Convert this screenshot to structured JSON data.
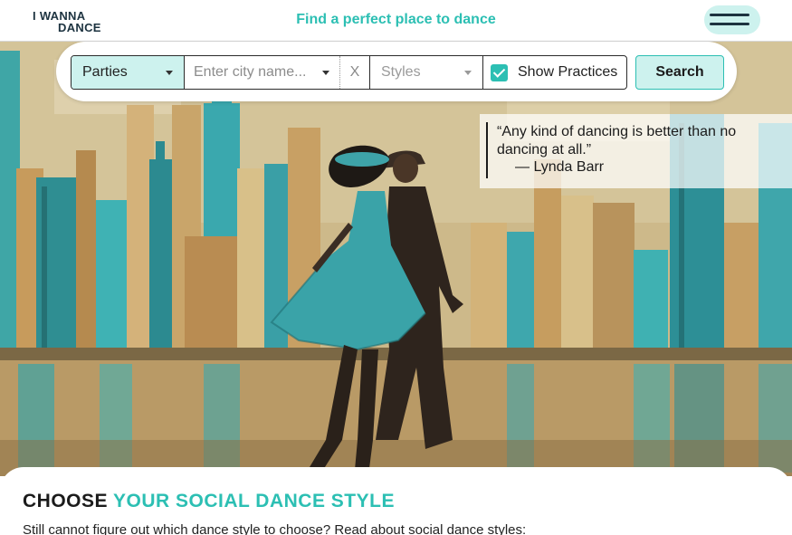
{
  "header": {
    "logo_line1": "I WANNA",
    "logo_line2": "DANCE",
    "tagline": "Find a perfect place to dance",
    "menu_icon": "hamburger-icon"
  },
  "search": {
    "event_type": "Parties",
    "city_placeholder": "Enter city name...",
    "clear_label": "X",
    "styles_placeholder": "Styles",
    "show_practices_label": "Show Practices",
    "show_practices_checked": true,
    "search_label": "Search"
  },
  "quote": {
    "text": "Any kind of dancing is better than no dancing at all.",
    "author": "— Lynda Barr"
  },
  "section": {
    "title_part1": "CHOOSE",
    "title_part2": "YOUR SOCIAL DANCE STYLE",
    "subtitle": "Still cannot figure out which dance style to choose? Read about social dance styles:"
  },
  "colors": {
    "accent": "#2cbfb3",
    "accent_light": "#cdf2ee",
    "dark": "#1d3340"
  }
}
